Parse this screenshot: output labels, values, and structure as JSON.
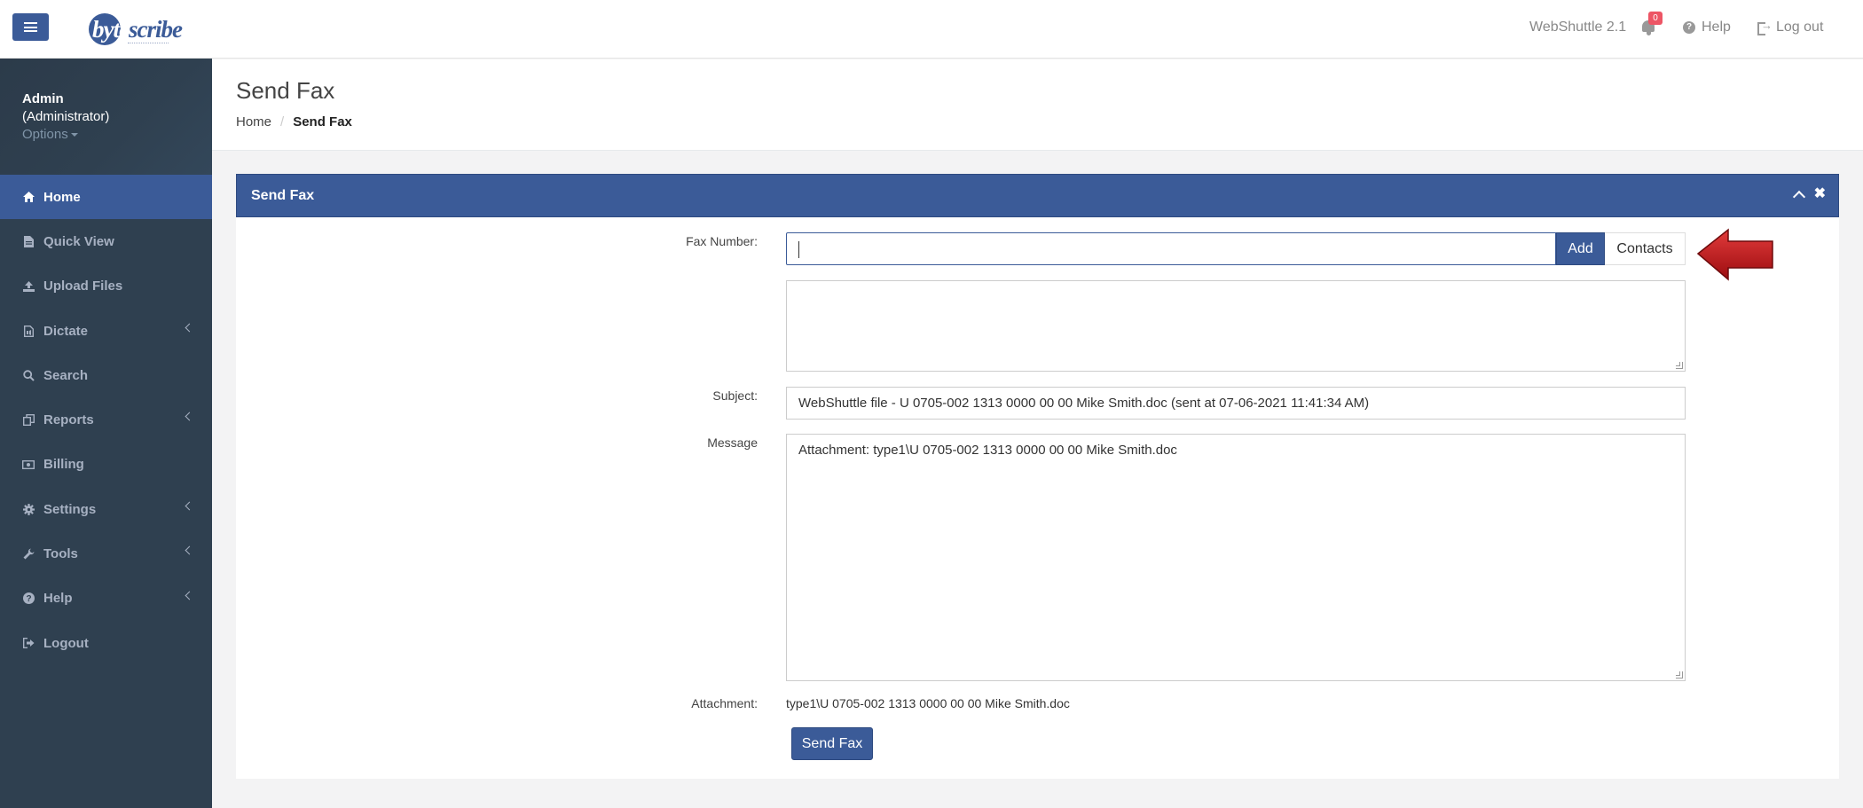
{
  "topbar": {
    "version": "WebShuttle 2.1",
    "notification_count": "0",
    "help": "Help",
    "logout": "Log out"
  },
  "logo": {
    "text_dark_1": "by",
    "text_light": "te",
    "text_dark_2": "scribe"
  },
  "profile": {
    "name": "Admin",
    "role": "(Administrator)",
    "options": "Options"
  },
  "sidebar": {
    "items": [
      {
        "label": "Home",
        "icon": "home-icon",
        "active": true,
        "submenu": false
      },
      {
        "label": "Quick View",
        "icon": "file-icon",
        "active": false,
        "submenu": false
      },
      {
        "label": "Upload Files",
        "icon": "upload-icon",
        "active": false,
        "submenu": false
      },
      {
        "label": "Dictate",
        "icon": "audio-file-icon",
        "active": false,
        "submenu": true
      },
      {
        "label": "Search",
        "icon": "search-icon",
        "active": false,
        "submenu": false
      },
      {
        "label": "Reports",
        "icon": "copy-icon",
        "active": false,
        "submenu": true
      },
      {
        "label": "Billing",
        "icon": "money-icon",
        "active": false,
        "submenu": false
      },
      {
        "label": "Settings",
        "icon": "gear-icon",
        "active": false,
        "submenu": true
      },
      {
        "label": "Tools",
        "icon": "wrench-icon",
        "active": false,
        "submenu": true
      },
      {
        "label": "Help",
        "icon": "question-icon",
        "active": false,
        "submenu": true
      },
      {
        "label": "Logout",
        "icon": "sign-out-icon",
        "active": false,
        "submenu": false
      }
    ]
  },
  "page": {
    "title": "Send Fax",
    "breadcrumb": {
      "home": "Home",
      "current": "Send Fax"
    }
  },
  "form": {
    "panel_title": "Send Fax",
    "fax_number_label": "Fax Number:",
    "fax_number_value": "",
    "add_label": "Add",
    "contacts_label": "Contacts",
    "subject_label": "Subject:",
    "subject_value": "WebShuttle file - U 0705-002 1313 0000 00 00 Mike Smith.doc (sent at 07-06-2021 11:41:34 AM)",
    "message_label": "Message",
    "message_value": "Attachment:  type1\\U 0705-002 1313 0000 00 00 Mike Smith.doc",
    "attachment_label": "Attachment:",
    "attachment_value": "type1\\U 0705-002 1313 0000 00 00 Mike Smith.doc",
    "send_label": "Send Fax"
  },
  "colors": {
    "brand": "#3b5b98",
    "sidebar_bg": "#2f4050",
    "badge": "#ed5565",
    "arrow": "#c4161c"
  }
}
